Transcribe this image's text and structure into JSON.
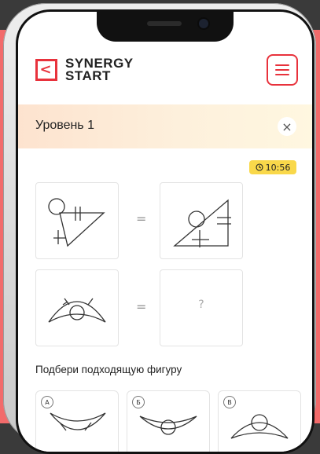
{
  "header": {
    "logo_mark": "<",
    "logo_line1": "SYNERGY",
    "logo_line2": "START",
    "menu_icon": "hamburger-icon"
  },
  "level": {
    "title": "Уровень 1",
    "close_icon": "close-icon",
    "close_glyph": "×"
  },
  "timer": {
    "time": "10:56",
    "icon": "clock-icon"
  },
  "puzzle": {
    "equals_sign": "=",
    "unknown": "?"
  },
  "prompt": "Подбери подходящую фигуру",
  "options": [
    {
      "label": "А"
    },
    {
      "label": "Б"
    },
    {
      "label": "В"
    }
  ],
  "colors": {
    "brand_red": "#e8323c",
    "timer_yellow": "#f9d84a",
    "side_bg": "#f26b6b"
  }
}
